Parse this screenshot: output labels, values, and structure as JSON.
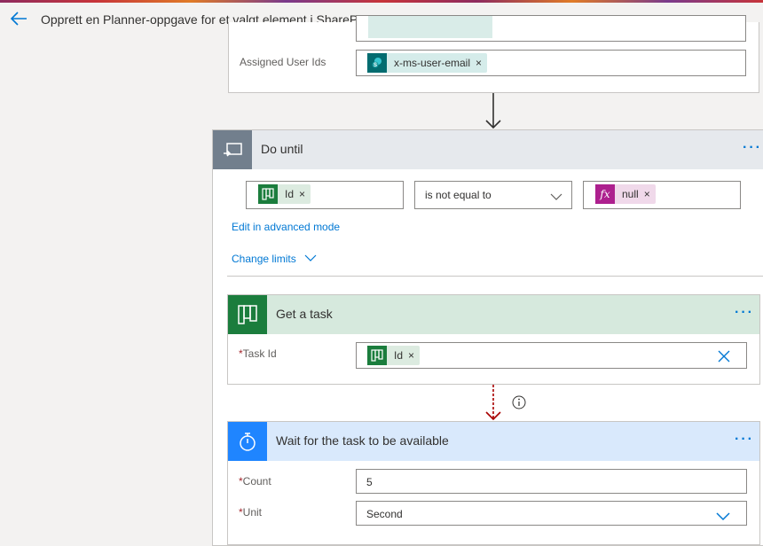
{
  "header": {
    "title": "Opprett en Planner-oppgave for et valgt element i SharePoint"
  },
  "prev_step": {
    "assigned_label": "Assigned User Ids",
    "assigned_token": "x-ms-user-email"
  },
  "do_until": {
    "title": "Do until",
    "left_token": "Id",
    "operator": "is not equal to",
    "right_token": "null",
    "advanced_link": "Edit in advanced mode",
    "limits_link": "Change limits"
  },
  "get_task": {
    "title": "Get a task",
    "task_id_label": "Task Id",
    "task_id_token": "Id"
  },
  "wait": {
    "title": "Wait for the task to be available",
    "count_label": "Count",
    "count_value": "5",
    "unit_label": "Unit",
    "unit_value": "Second"
  },
  "colors": {
    "accent": "#0078d4",
    "planner_green": "#1b7d3d",
    "sharepoint_teal": "#036c70",
    "expression_magenta": "#ad208e",
    "loop_gray": "#727f8d",
    "delay_blue": "#1f85ff",
    "run_after_red": "#a80000"
  },
  "icons": [
    "back-arrow-icon",
    "sharepoint-icon",
    "loop-icon",
    "planner-icon",
    "fx-icon",
    "stopwatch-icon",
    "info-icon",
    "chevron-down-icon",
    "close-icon",
    "more-options-icon"
  ]
}
